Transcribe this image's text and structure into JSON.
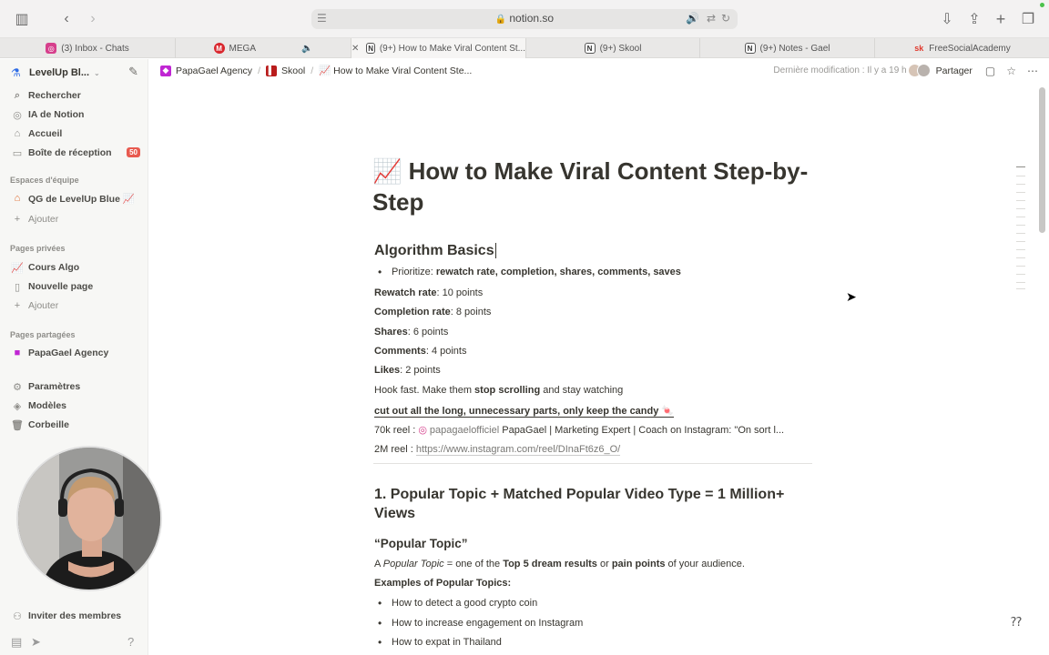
{
  "browser": {
    "url": "notion.so",
    "tabs": [
      {
        "label": "(3) Inbox - Chats",
        "icon": "instagram-icon",
        "color": "#d63f8c",
        "active": false
      },
      {
        "label": "MEGA",
        "icon": "mega-icon",
        "color": "#d9272e",
        "active": false
      },
      {
        "label": "(9+) How to Make Viral Content St...",
        "icon": "notion-icon",
        "color": "#333333",
        "active": true
      },
      {
        "label": "(9+) Skool",
        "icon": "notion-icon",
        "color": "#333333",
        "active": false
      },
      {
        "label": "(9+) Notes - Gael",
        "icon": "notion-icon",
        "color": "#333333",
        "active": false
      },
      {
        "label": "FreeSocialAcademy",
        "icon": "sk-icon",
        "color": "#e0382c",
        "active": false
      }
    ]
  },
  "sidebar": {
    "workspace": "LevelUp Bl...",
    "items_top": [
      {
        "label": "Rechercher",
        "icon": "search-icon",
        "glyph": "⌕"
      },
      {
        "label": "IA de Notion",
        "icon": "ai-icon",
        "glyph": "◎"
      },
      {
        "label": "Accueil",
        "icon": "home-icon",
        "glyph": "⌂"
      },
      {
        "label": "Boîte de réception",
        "icon": "inbox-icon",
        "glyph": "▭"
      }
    ],
    "inbox_badge": "50",
    "team_section": "Espaces d'équipe",
    "team_item": "QG de LevelUp Blue 📈",
    "add_label": "Ajouter",
    "private_section": "Pages privées",
    "private_items": [
      "Cours Algo",
      "Nouvelle page"
    ],
    "shared_section": "Pages partagées",
    "shared_item": "PapaGael Agency",
    "bottom_items": [
      {
        "label": "Paramètres",
        "icon": "settings-icon",
        "glyph": "⚙"
      },
      {
        "label": "Modèles",
        "icon": "templates-icon",
        "glyph": "◈"
      },
      {
        "label": "Corbeille",
        "icon": "trash-icon",
        "glyph": "🗑"
      }
    ],
    "invite": "Inviter des membres"
  },
  "header": {
    "crumbs": [
      "PapaGael Agency",
      "Skool",
      "📈 How to Make Viral Content Ste..."
    ],
    "last_modified": "Dernière modification : Il y a 19 h",
    "share": "Partager"
  },
  "page": {
    "title": "📈 How to Make Viral Content Step-by-Step",
    "section1": "Algorithm Basics",
    "bullet1_prefix": "Prioritize: ",
    "bullet1_bold": "rewatch rate, completion, shares, comments, saves",
    "rows": [
      {
        "bold": "Rewatch rate",
        "rest": ": 10 points"
      },
      {
        "bold": "Completion rate",
        "rest": ": 8 points"
      },
      {
        "bold": "Shares",
        "rest": ": 6 points"
      },
      {
        "bold": "Comments",
        "rest": ": 4 points"
      },
      {
        "bold": "Likes",
        "rest": ": 2 points"
      }
    ],
    "hook_a": "Hook fast. Make them ",
    "hook_b": "stop scrolling",
    "hook_c": " and stay watching",
    "cut": "cut out all the long, unnecessary parts, only keep the candy 🍬",
    "reel70_label": "70k reel : ",
    "reel70_user": "papagaelofficiel",
    "reel70_text": "PapaGael | Marketing Expert | Coach on Instagram: \"On sort l...",
    "reel2m_label": "2M reel : ",
    "reel2m_url": "https://www.instagram.com/reel/DInaFt6z6_O/",
    "section2": "1. Popular Topic + Matched Popular Video Type = 1 Million+ Views",
    "section3": "“Popular Topic”",
    "pt_a": "A ",
    "pt_b": "Popular Topic",
    "pt_c": " = one of the ",
    "pt_d": "Top 5 dream results",
    "pt_e": " or ",
    "pt_f": "pain points",
    "pt_g": " of your audience.",
    "examples": "Examples of Popular Topics:",
    "example_items": [
      "How to detect a good crypto coin",
      "How to increase engagement on Instagram",
      "How to expat in Thailand"
    ]
  }
}
